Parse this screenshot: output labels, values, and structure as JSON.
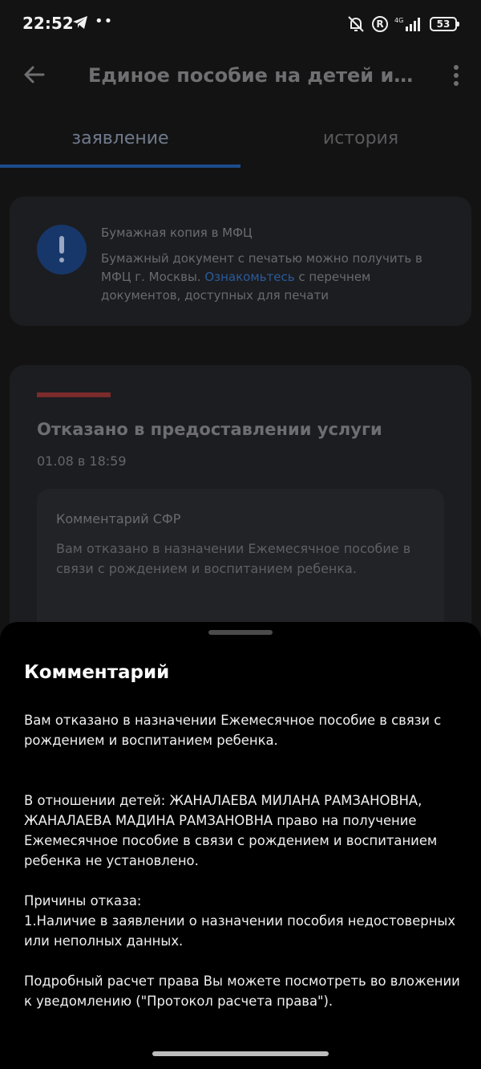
{
  "status_bar": {
    "time": "22:52",
    "network": "4G",
    "battery": "53",
    "icons": [
      "telegram-icon",
      "more-dots-icon",
      "muted-bell-icon",
      "r-circle-icon",
      "signal-icon",
      "battery-icon"
    ]
  },
  "app_bar": {
    "title": "Единое пособие на детей и бере..."
  },
  "tabs": [
    {
      "label": "заявление",
      "active": true
    },
    {
      "label": "история",
      "active": false
    }
  ],
  "info_card": {
    "title": "Бумажная копия в МФЦ",
    "text_before": "Бумажный документ с печатью можно получить в МФЦ г. Москвы. ",
    "link": "Ознакомьтесь",
    "text_after": " с перечнем документов, доступных для печати"
  },
  "status_card": {
    "title": "Отказано в предоставлении услуги",
    "date": "01.08 в 18:59",
    "comment_title": "Комментарий СФР",
    "comment_text": "Вам отказано в назначении Ежемесячное пособие в связи с рождением и воспитанием ребенка."
  },
  "sheet": {
    "title": "Комментарий",
    "p1": "Вам отказано в назначении Ежемесячное пособие в связи с рождением и воспитанием ребенка.",
    "p2": "В отношении детей: ЖАНАЛАЕВА МИЛАНА РАМЗАНОВНА, ЖАНАЛАЕВА МАДИНА РАМЗАНОВНА право на получение Ежемесячное пособие в связи с рождением и воспитанием ребенка не установлено.",
    "p3_title": "Причины отказа:",
    "p3_item": "1.Наличие в заявлении о назначении пособия недостоверных или неполных данных.",
    "p4": "Подробный расчет права Вы можете посмотреть во вложении к уведомлению (\"Протокол расчета права\")."
  },
  "colors": {
    "accent_blue": "#1c4d8c",
    "status_red": "#7a2b2b",
    "background": "#131313"
  }
}
